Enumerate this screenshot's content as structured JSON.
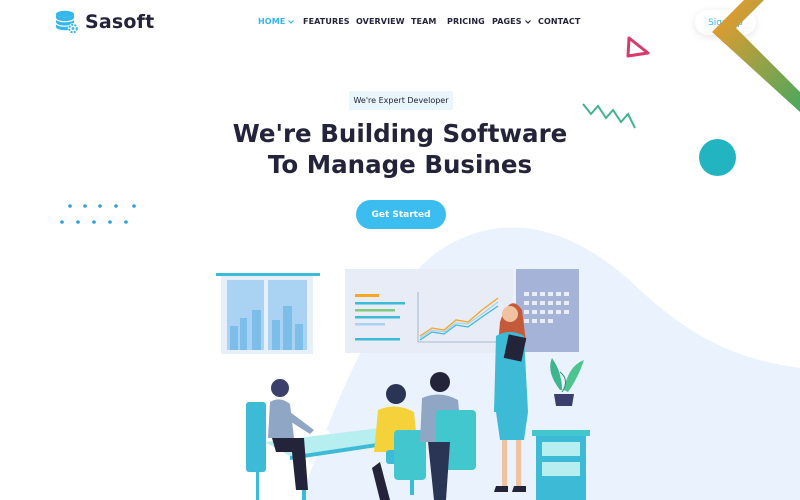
{
  "brand": {
    "name": "Sasoft",
    "logo_icon": "database-gear-icon"
  },
  "nav": {
    "items": [
      {
        "label": "HOME",
        "has_dropdown": true,
        "active": true
      },
      {
        "label": "FEATURES",
        "has_dropdown": false,
        "active": false
      },
      {
        "label": "OVERVIEW",
        "has_dropdown": false,
        "active": false
      },
      {
        "label": "TEAM",
        "has_dropdown": false,
        "active": false
      },
      {
        "label": "PRICING",
        "has_dropdown": false,
        "active": false
      },
      {
        "label": "PAGES",
        "has_dropdown": true,
        "active": false
      },
      {
        "label": "CONTACT",
        "has_dropdown": false,
        "active": false
      }
    ],
    "signup_label": "Sign Up"
  },
  "hero": {
    "badge": "We're Expert Developer",
    "title_line1": "We're Building Software",
    "title_line2": "To Manage Busines",
    "cta_label": "Get Started"
  },
  "colors": {
    "accent": "#36b6ea",
    "heading": "#23233a",
    "teal": "#23b4c2",
    "wave": "#eaf3fd"
  }
}
